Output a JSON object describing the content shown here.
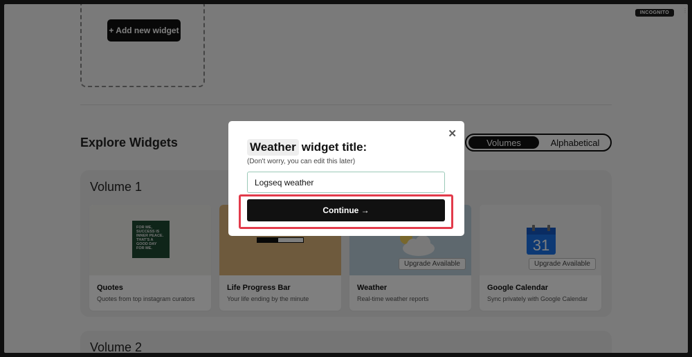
{
  "browser": {
    "incognito_label": "INCOGNITO"
  },
  "top": {
    "add_widget_label": "+ Add new widget"
  },
  "explore": {
    "title": "Explore Widgets",
    "sort_options": [
      "Volumes",
      "Alphabetical"
    ],
    "selected_sort": "Volumes"
  },
  "volumes": [
    {
      "title": "Volume 1",
      "cards": [
        {
          "title": "Quotes",
          "desc": "Quotes from top instagram curators",
          "thumb_color": "#efefea",
          "quote_text": "FOR ME, SUCCESS IS INNER PEACE. THAT'S A GOOD DAY FOR ME."
        },
        {
          "title": "Life Progress Bar",
          "desc": "Your life ending by the minute",
          "thumb_color": "#dcb57a",
          "progress": 0.45
        },
        {
          "title": "Weather",
          "desc": "Real-time weather reports",
          "thumb_color": "#bcd0dd",
          "badge": "Upgrade Available"
        },
        {
          "title": "Google Calendar",
          "desc": "Sync privately with Google Calendar",
          "thumb_color": "#f2f2f2",
          "badge": "Upgrade Available",
          "calendar_day": "31"
        }
      ]
    },
    {
      "title": "Volume 2"
    }
  ],
  "modal": {
    "title_chip": "Weather",
    "title_rest": "widget title:",
    "subtitle": "(Don't worry, you can edit this later)",
    "input_value": "Logseq weather",
    "continue_label": "Continue →",
    "close_icon": "close-icon"
  },
  "colors": {
    "highlight": "#e23b4b",
    "accent_dark": "#111111",
    "quote_bg": "#1f4a33",
    "calendar_blue": "#1a73e8"
  }
}
